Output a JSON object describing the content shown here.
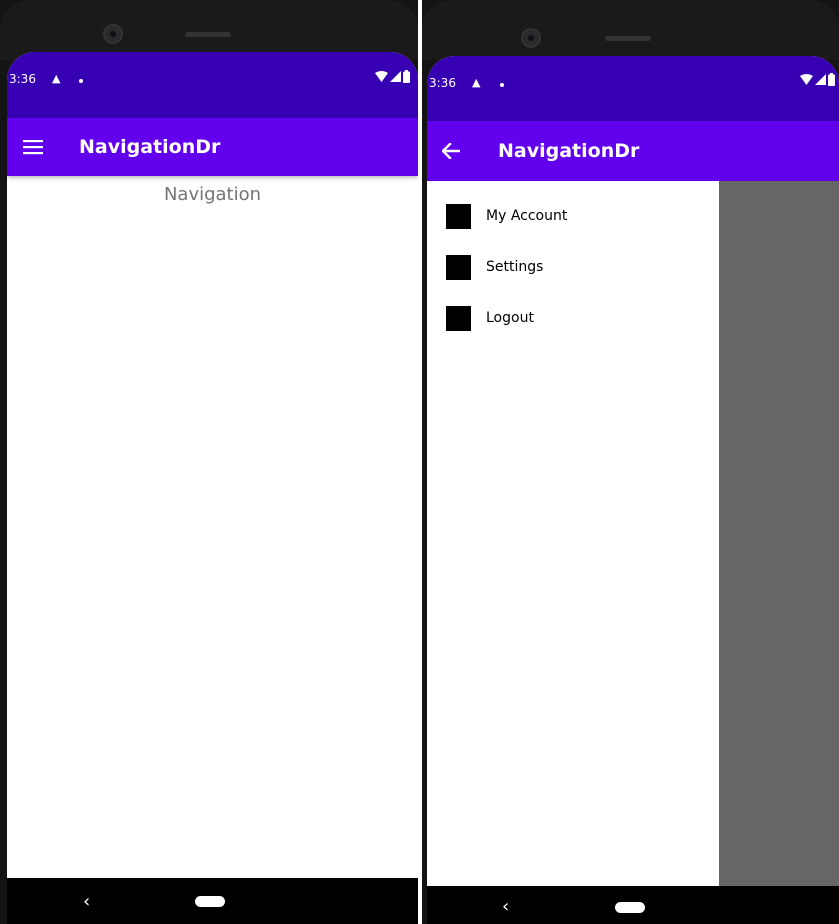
{
  "colors": {
    "status_bar": "#3700b3",
    "app_bar": "#6200ee",
    "scrim": "#666666",
    "text_secondary": "#757575"
  },
  "left_phone": {
    "status_bar": {
      "time": "3:36",
      "alert_icon": "warning-icon",
      "right_icons": [
        "wifi-icon",
        "signal-icon",
        "battery-icon"
      ]
    },
    "app_bar": {
      "nav_icon": "hamburger-menu-icon",
      "title": "NavigationDr"
    },
    "content": {
      "text": "Navigation"
    },
    "nav_bar": {
      "back_icon": "back-chevron-icon",
      "home_icon": "home-pill-icon"
    }
  },
  "right_phone": {
    "status_bar": {
      "time": "3:36",
      "alert_icon": "warning-icon",
      "right_icons": [
        "wifi-icon",
        "signal-icon",
        "battery-icon"
      ]
    },
    "app_bar": {
      "nav_icon": "arrow-back-icon",
      "title": "NavigationDr"
    },
    "drawer": {
      "items": [
        {
          "label": "My Account",
          "icon": "square-icon"
        },
        {
          "label": "Settings",
          "icon": "square-icon"
        },
        {
          "label": "Logout",
          "icon": "square-icon"
        }
      ]
    },
    "nav_bar": {
      "back_icon": "back-chevron-icon",
      "home_icon": "home-pill-icon"
    }
  }
}
